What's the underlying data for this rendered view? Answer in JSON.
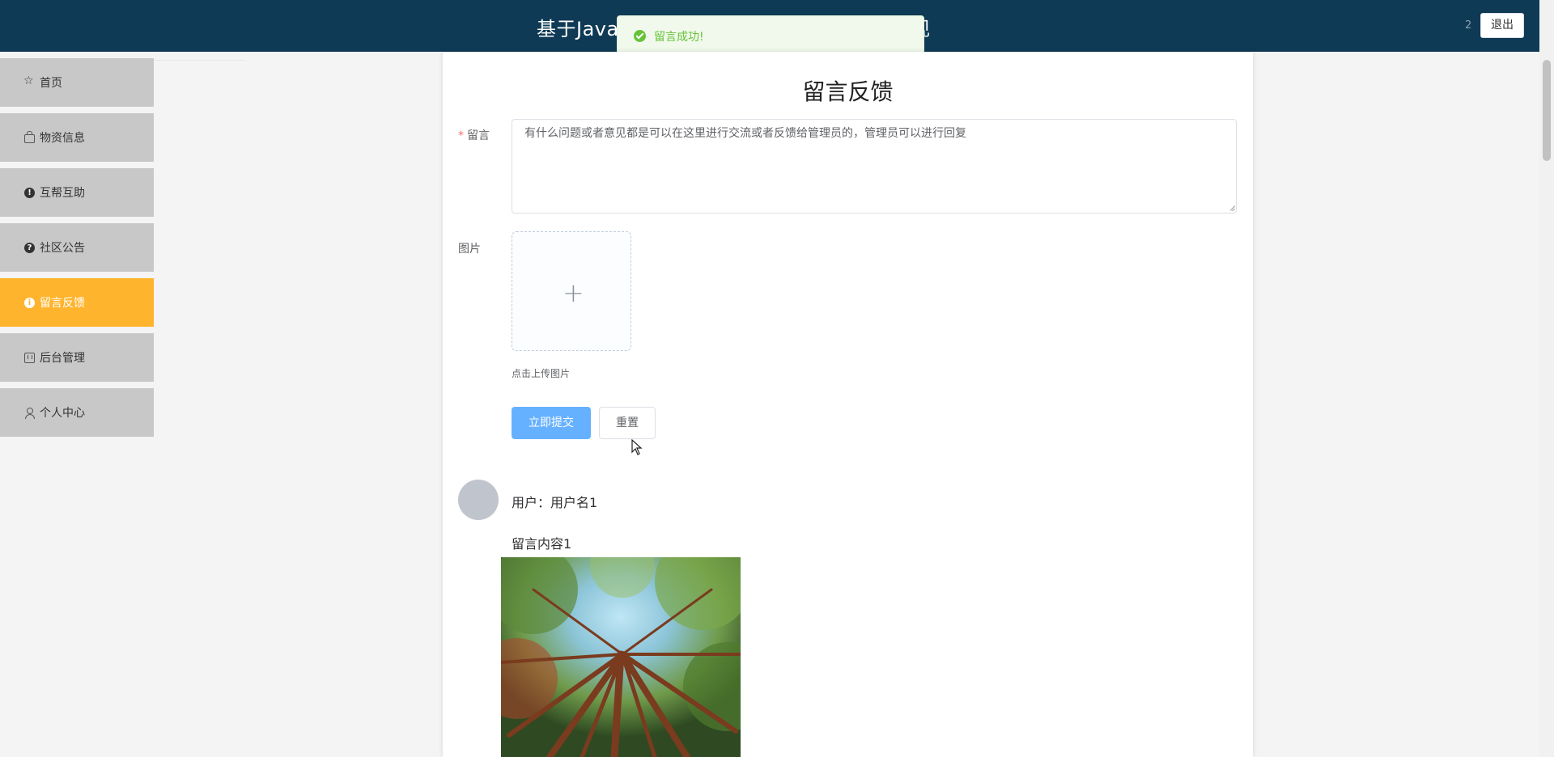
{
  "header": {
    "title_left": "基于Java",
    "title_right": "现",
    "user_indicator": "2",
    "logout_label": "退出"
  },
  "toast": {
    "message": "留言成功!"
  },
  "sidebar": {
    "items": [
      {
        "label": "首页",
        "icon": "star-icon"
      },
      {
        "label": "物资信息",
        "icon": "bag-icon"
      },
      {
        "label": "互帮互助",
        "icon": "exclamation-icon"
      },
      {
        "label": "社区公告",
        "icon": "question-icon"
      },
      {
        "label": "留言反馈",
        "icon": "info-icon",
        "active": true
      },
      {
        "label": "后台管理",
        "icon": "box-icon"
      },
      {
        "label": "个人中心",
        "icon": "user-icon"
      }
    ]
  },
  "form": {
    "title": "留言反馈",
    "message_label": "留言",
    "message_value": "有什么问题或者意见都是可以在这里进行交流或者反馈给管理员的，管理员可以进行回复",
    "image_label": "图片",
    "upload_tip": "点击上传图片",
    "submit_label": "立即提交",
    "reset_label": "重置"
  },
  "messages": [
    {
      "user": "用户：用户名1",
      "content": "留言内容1"
    }
  ],
  "colors": {
    "header_bg": "#0f3a55",
    "active_item": "#ffb42e",
    "sidebar_item": "#c8c8c8",
    "primary_button": "#66b1ff",
    "success": "#67c23a"
  }
}
